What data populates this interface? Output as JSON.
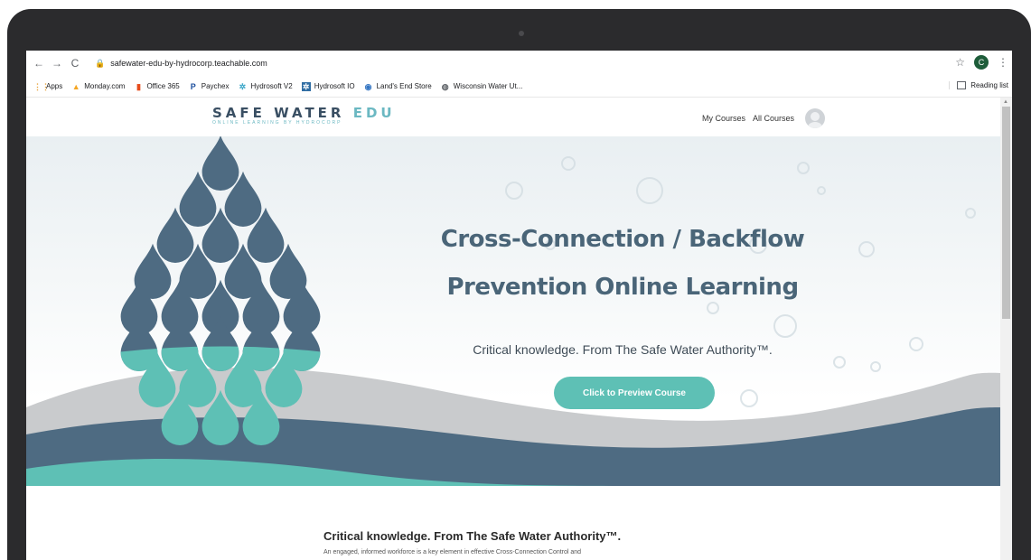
{
  "browser": {
    "url": "safewater-edu-by-hydrocorp.teachable.com",
    "profile_initial": "C",
    "bookmarks": [
      {
        "label": "Apps",
        "icon": "apps-grid-icon",
        "color": "#e8a33b"
      },
      {
        "label": "Monday.com",
        "icon": "monday-icon",
        "color": "#f5a623"
      },
      {
        "label": "Office 365",
        "icon": "office-icon",
        "color": "#e74c1c"
      },
      {
        "label": "Paychex",
        "icon": "paychex-icon",
        "color": "#1d4f9e"
      },
      {
        "label": "Hydrosoft V2",
        "icon": "hydrosoft-icon",
        "color": "#3aa6c8"
      },
      {
        "label": "Hydrosoft IO",
        "icon": "hydrosoft-io-icon",
        "color": "#2f6da3"
      },
      {
        "label": "Land's End Store",
        "icon": "landsend-icon",
        "color": "#3576c3"
      },
      {
        "label": "Wisconsin Water Ut...",
        "icon": "globe-icon",
        "color": "#5f6368"
      }
    ],
    "reading_list": "Reading list"
  },
  "site": {
    "logo_main_a": "SAFE WATER",
    "logo_main_b": " EDU",
    "logo_sub": "ONLINE LEARNING BY HYDROCORP",
    "nav": {
      "my_courses": "My Courses",
      "all_courses": "All Courses"
    }
  },
  "hero": {
    "title_line1": "Cross-Connection / Backflow",
    "title_line2": "Prevention Online Learning",
    "tagline": "Critical knowledge. From The Safe Water Authority™.",
    "cta": "Click to Preview Course"
  },
  "section": {
    "title": "Critical knowledge. From The Safe Water Authority™.",
    "body": "An engaged, informed workforce is a key element in effective Cross-Connection Control and"
  },
  "colors": {
    "dark_blue": "#4e6b82",
    "teal": "#5ec0b5",
    "wave_grey": "#c9cbcd"
  }
}
